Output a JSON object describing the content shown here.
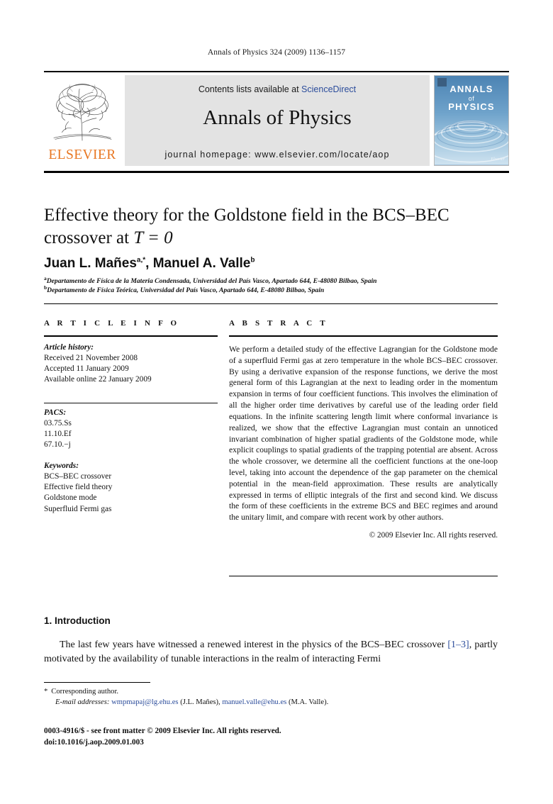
{
  "running_head": "Annals of Physics 324 (2009) 1136–1157",
  "masthead": {
    "elsevier_wordmark": "ELSEVIER",
    "contents_prefix": "Contents lists available at ",
    "contents_link": "ScienceDirect",
    "journal_title": "Annals of Physics",
    "homepage": "journal homepage: www.elsevier.com/locate/aop",
    "cover": {
      "line1": "ANNALS",
      "line2": "of",
      "line3": "PHYSICS",
      "signature": "Elsevier"
    },
    "colors": {
      "elsevier_orange": "#E87722",
      "banner_grey": "#e3e3e3",
      "link_blue": "#2b4c9b",
      "cover_blue": "#4a7fae"
    }
  },
  "article": {
    "title_line1": "Effective theory for the Goldstone field in the BCS–BEC",
    "title_line2_pre": "crossover at ",
    "title_line2_math": "T = 0",
    "authors": "Juan L. Mañes",
    "author1_sup": "a,*",
    "authors_mid": ", Manuel A. Valle",
    "author2_sup": "b",
    "affiliation_a_sup": "a",
    "affiliation_a": "Departamento de Física de la Materia Condensada, Universidad del País Vasco, Apartado 644, E-48080 Bilbao, Spain",
    "affiliation_b_sup": "b",
    "affiliation_b": "Departamento de Física Teórica, Universidad del País Vasco, Apartado 644, E-48080 Bilbao, Spain"
  },
  "info": {
    "heading": "A R T I C L E    I N F O",
    "history_label": "Article history:",
    "history": [
      "Received 21 November 2008",
      "Accepted 11 January 2009",
      "Available online 22 January 2009"
    ],
    "pacs_label": "PACS:",
    "pacs": [
      "03.75.Ss",
      "11.10.Ef",
      "67.10.−j"
    ],
    "keywords_label": "Keywords:",
    "keywords": [
      "BCS–BEC crossover",
      "Effective field theory",
      "Goldstone mode",
      "Superfluid Fermi gas"
    ]
  },
  "abstract": {
    "heading": "A B S T R A C T",
    "text": "We perform a detailed study of the effective Lagrangian for the Goldstone mode of a superfluid Fermi gas at zero temperature in the whole BCS–BEC crossover. By using a derivative expansion of the response functions, we derive the most general form of this Lagrangian at the next to leading order in the momentum expansion in terms of four coefficient functions. This involves the elimination of all the higher order time derivatives by careful use of the leading order field equations. In the infinite scattering length limit where conformal invariance is realized, we show that the effective Lagrangian must contain an unnoticed invariant combination of higher spatial gradients of the Goldstone mode, while explicit couplings to spatial gradients of the trapping potential are absent. Across the whole crossover, we determine all the coefficient functions at the one-loop level, taking into account the dependence of the gap parameter on the chemical potential in the mean-field approximation. These results are analytically expressed in terms of elliptic integrals of the first and second kind. We discuss the form of these coefficients in the extreme BCS and BEC regimes and around the unitary limit, and compare with recent work by other authors.",
    "copyright": "© 2009 Elsevier Inc. All rights reserved."
  },
  "body": {
    "section_number_title": "1. Introduction",
    "paragraph_pre": "The last few years have witnessed a renewed interest in the physics of the BCS–BEC crossover ",
    "paragraph_ref": "[1–3]",
    "paragraph_post": ", partly motivated by the availability of tunable interactions in the realm of interacting Fermi"
  },
  "footnotes": {
    "corresponding_marker": "*",
    "corresponding": "Corresponding author.",
    "email_label": "E-mail addresses:",
    "email1": "wmpmapaj@lg.ehu.es",
    "email1_owner": " (J.L. Mañes), ",
    "email2": "manuel.valle@ehu.es",
    "email2_owner": " (M.A. Valle).",
    "issn_line": "0003-4916/$ - see front matter © 2009 Elsevier Inc. All rights reserved.",
    "doi_line": "doi:10.1016/j.aop.2009.01.003"
  }
}
